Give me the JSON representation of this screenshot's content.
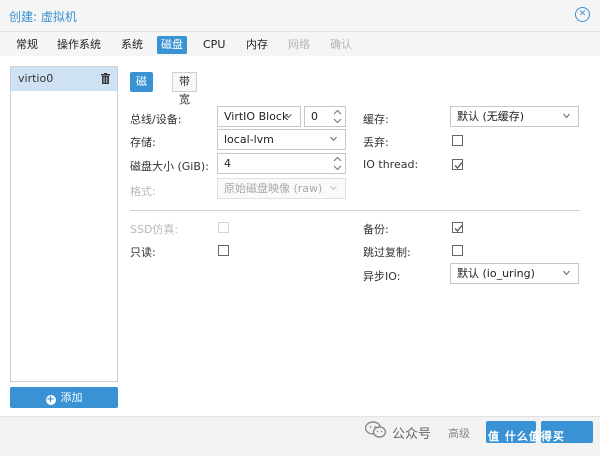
{
  "window": {
    "title": "创建: 虚拟机"
  },
  "tabs": [
    {
      "label": "常规",
      "active": false,
      "disabled": false
    },
    {
      "label": "操作系统",
      "active": false,
      "disabled": false
    },
    {
      "label": "系统",
      "active": false,
      "disabled": false
    },
    {
      "label": "磁盘",
      "active": true,
      "disabled": false
    },
    {
      "label": "CPU",
      "active": false,
      "disabled": false
    },
    {
      "label": "内存",
      "active": false,
      "disabled": false
    },
    {
      "label": "网络",
      "active": false,
      "disabled": true
    },
    {
      "label": "确认",
      "active": false,
      "disabled": true
    }
  ],
  "disk_list": {
    "items": [
      {
        "label": "virtio0"
      }
    ],
    "add_label": "添加"
  },
  "subtabs": [
    {
      "label": "磁盘",
      "active": true
    },
    {
      "label": "带宽",
      "active": false
    }
  ],
  "form": {
    "bus_device": {
      "label": "总线/设备:",
      "bus": "VirtIO Block",
      "index": "0"
    },
    "storage": {
      "label": "存储:",
      "value": "local-lvm"
    },
    "disk_size": {
      "label": "磁盘大小 (GiB):",
      "value": "4"
    },
    "format": {
      "label": "格式:",
      "value": "原始磁盘映像 (raw)"
    },
    "cache": {
      "label": "缓存:",
      "value": "默认 (无缓存)"
    },
    "discard": {
      "label": "丢弃:",
      "checked": false
    },
    "io_thread": {
      "label": "IO thread:",
      "checked": true
    },
    "ssd_emulation": {
      "label": "SSD仿真:",
      "checked": false
    },
    "read_only": {
      "label": "只读:",
      "checked": false
    },
    "backup": {
      "label": "备份:",
      "checked": true
    },
    "skip_replication": {
      "label": "跳过复制:",
      "checked": false
    },
    "async_io": {
      "label": "异步IO:",
      "value": "默认 (io_uring)"
    }
  },
  "watermark": {
    "text": "公众号",
    "partial": "高级",
    "site": "值 什么值得买"
  },
  "colors": {
    "accent": "#3892d4",
    "selected_row": "#cfe2f3"
  }
}
